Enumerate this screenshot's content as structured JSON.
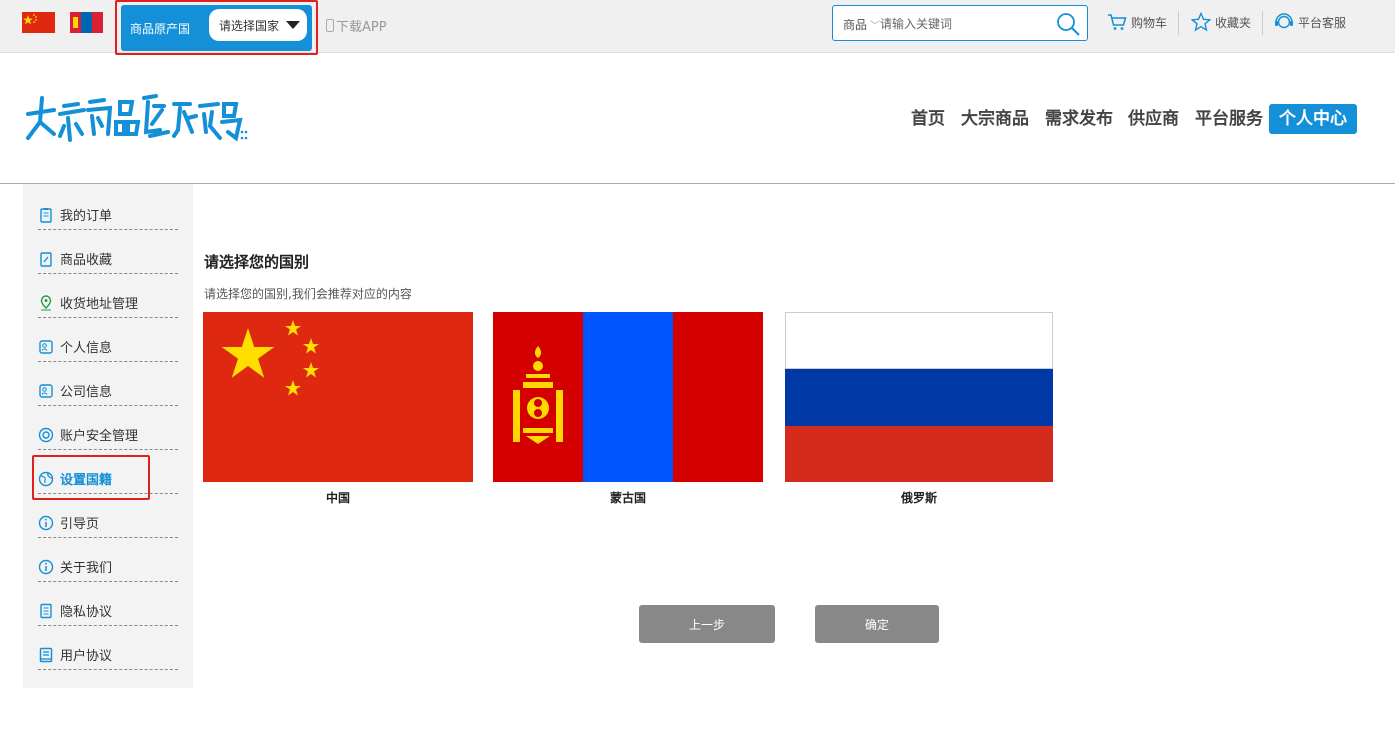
{
  "topbar": {
    "origin_label": "商品原产国",
    "country_select": "请选择国家",
    "app_link": "下载APP",
    "search": {
      "type": "商品",
      "placeholder": "请输入关键词"
    },
    "cart": "购物车",
    "favorites": "收藏夹",
    "service": "平台客服"
  },
  "nav": {
    "items": [
      "首页",
      "大宗商品",
      "需求发布",
      "供应商",
      "平台服务",
      "个人中心"
    ],
    "active": "个人中心"
  },
  "sidebar": {
    "items": [
      {
        "label": "我的订单",
        "icon": "clipboard-icon"
      },
      {
        "label": "商品收藏",
        "icon": "edit-doc-icon"
      },
      {
        "label": "收货地址管理",
        "icon": "map-pin-icon"
      },
      {
        "label": "个人信息",
        "icon": "id-card-icon"
      },
      {
        "label": "公司信息",
        "icon": "id-card-icon"
      },
      {
        "label": "账户安全管理",
        "icon": "shield-ring-icon"
      },
      {
        "label": "设置国籍",
        "icon": "globe-icon"
      },
      {
        "label": "引导页",
        "icon": "info-icon"
      },
      {
        "label": "关于我们",
        "icon": "info-icon"
      },
      {
        "label": "隐私协议",
        "icon": "document-icon"
      },
      {
        "label": "用户协议",
        "icon": "book-icon"
      }
    ],
    "active": "设置国籍"
  },
  "main": {
    "title": "请选择您的国别",
    "subtitle": "请选择您的国别,我们会推荐对应的内容",
    "countries": [
      {
        "name": "中国",
        "flag": "china-flag"
      },
      {
        "name": "蒙古国",
        "flag": "mongolia-flag"
      },
      {
        "name": "俄罗斯",
        "flag": "russia-flag"
      }
    ],
    "prev_button": "上一步",
    "confirm_button": "确定"
  },
  "colors": {
    "accent": "#1490d8",
    "highlight_border": "#e0201c",
    "button_gray": "#888888"
  }
}
